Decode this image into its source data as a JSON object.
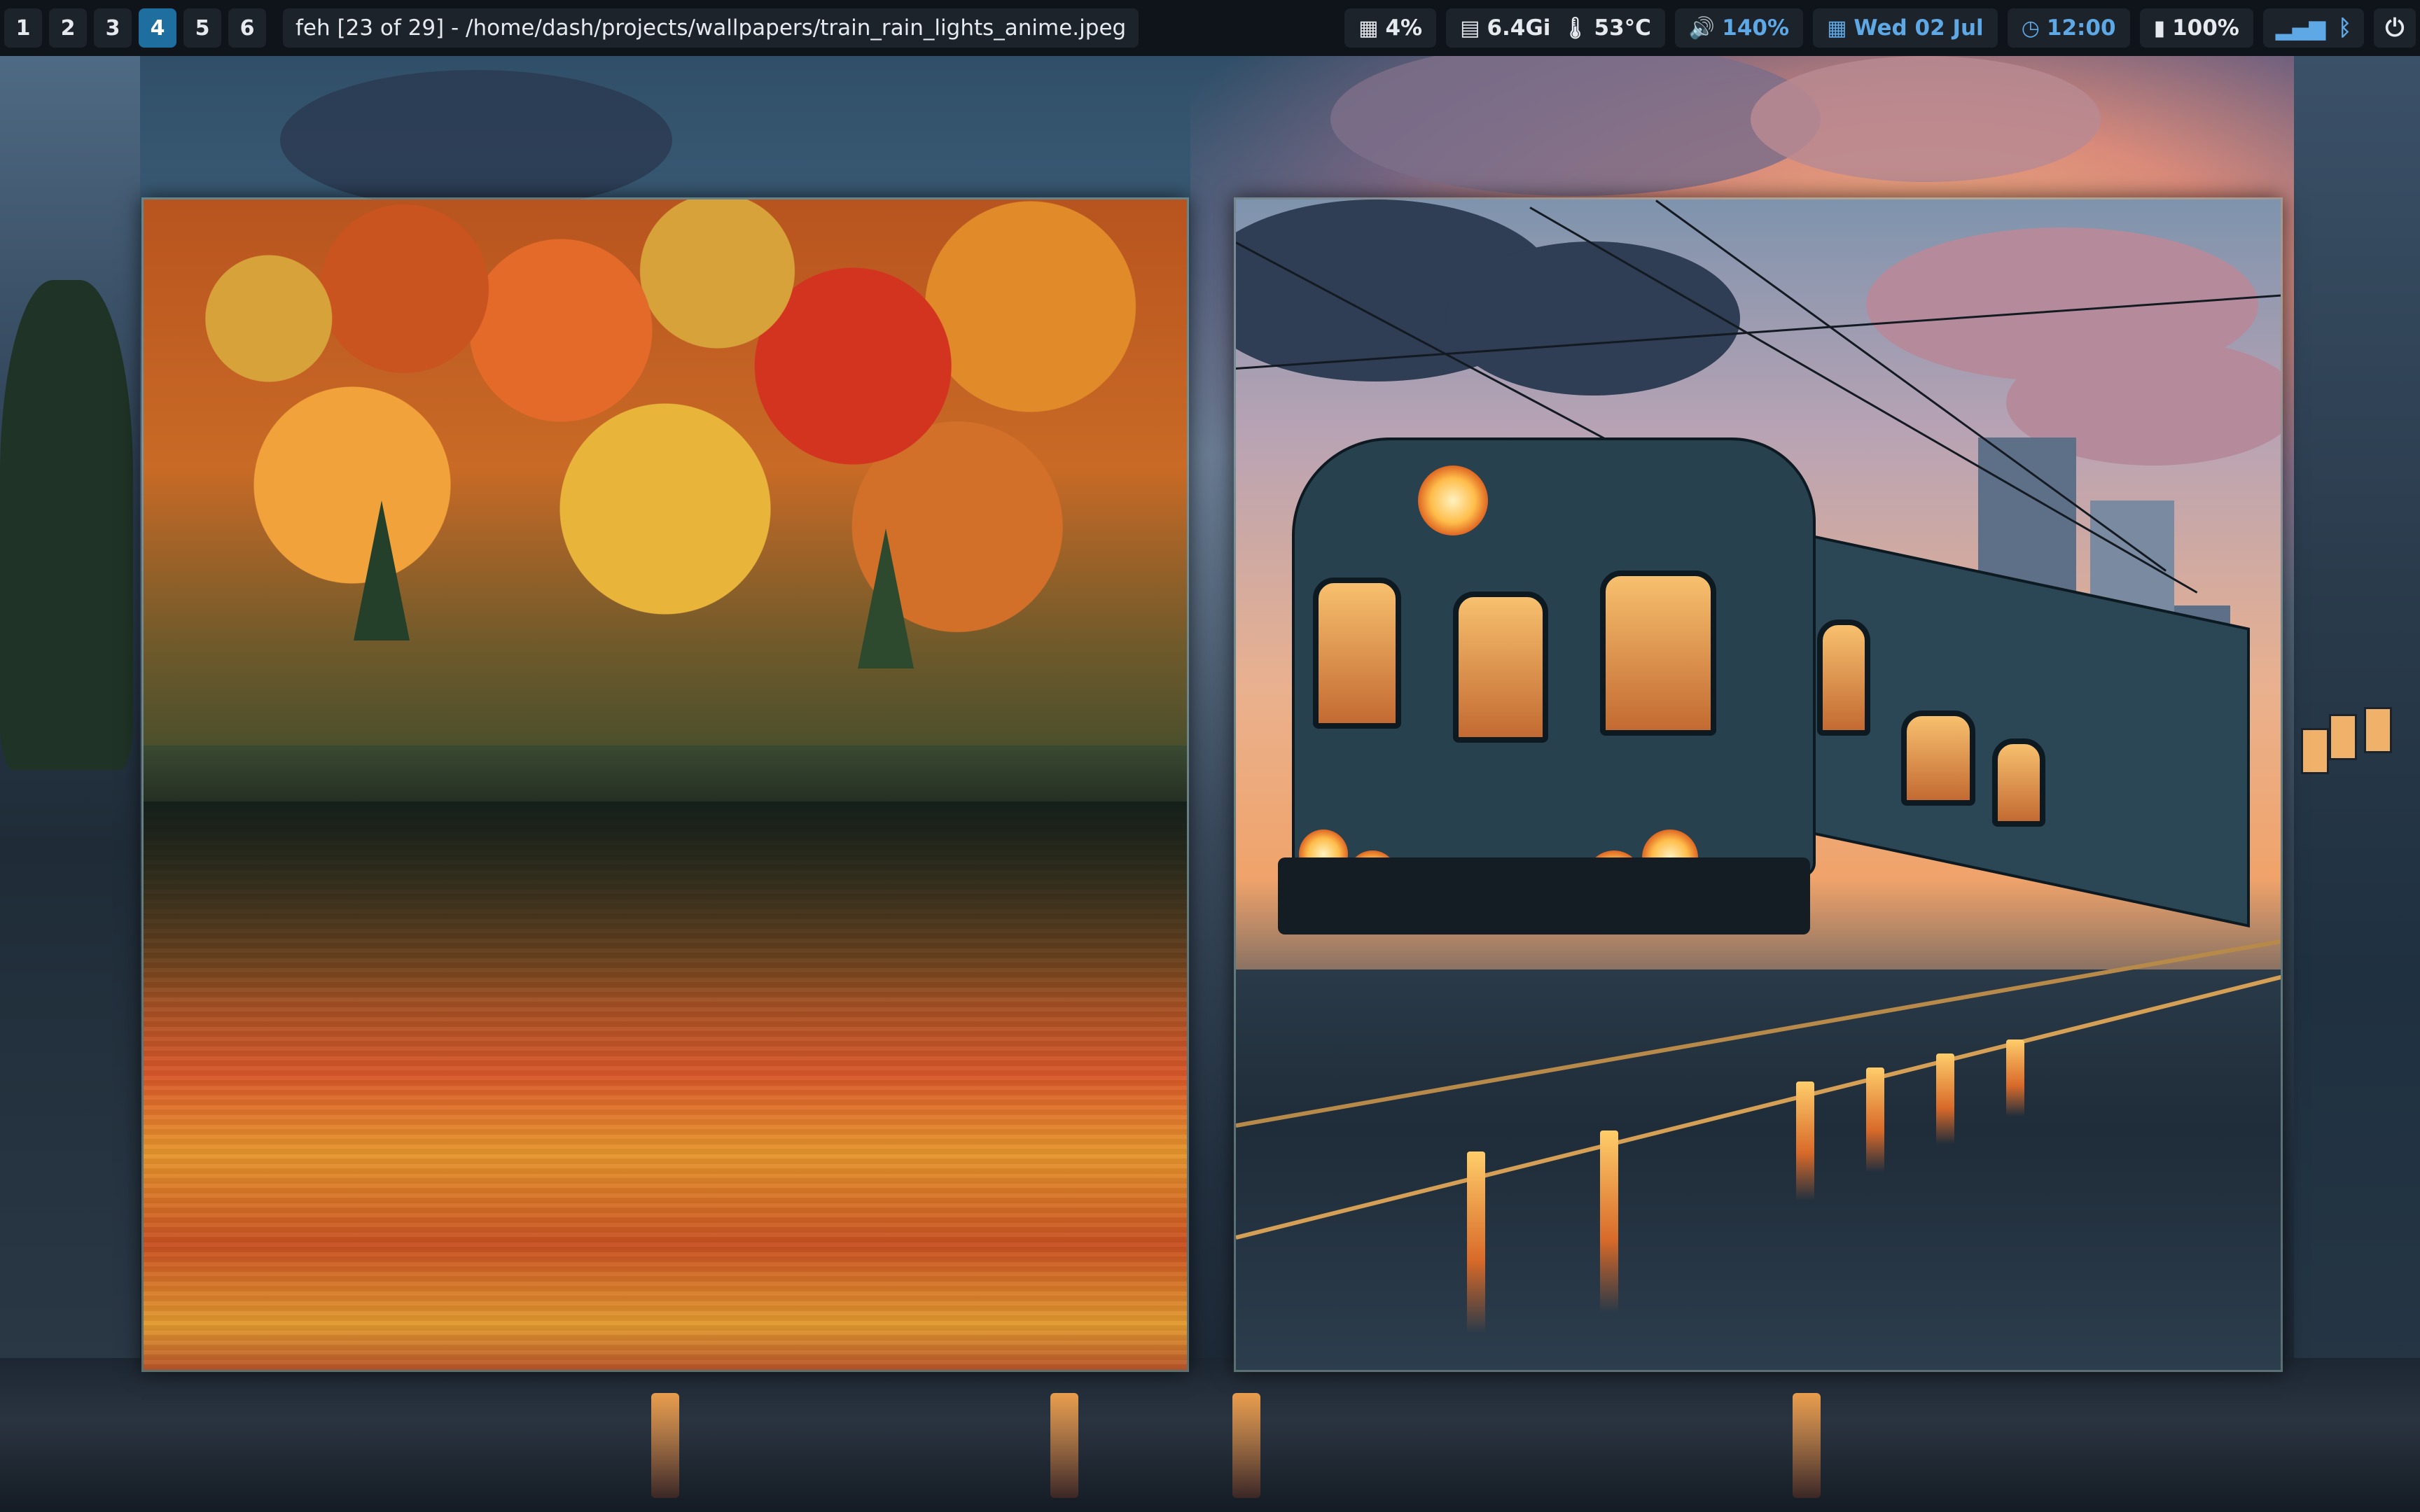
{
  "topbar": {
    "workspaces": [
      {
        "label": "1",
        "active": false
      },
      {
        "label": "2",
        "active": false
      },
      {
        "label": "3",
        "active": false
      },
      {
        "label": "4",
        "active": true
      },
      {
        "label": "5",
        "active": false
      },
      {
        "label": "6",
        "active": false
      }
    ],
    "window_title": "feh [23 of 29] - /home/dash/projects/wallpapers/train_rain_lights_anime.jpeg",
    "status": {
      "cpu": "4%",
      "memory": "6.4Gi",
      "temperature": "53°C",
      "volume": "140%",
      "date": "Wed 02 Jul",
      "time": "12:00",
      "battery": "100%"
    },
    "icons": {
      "cpu": "cpu-icon",
      "memory": "memory-icon",
      "temperature": "thermometer-icon",
      "volume": "speaker-icon",
      "date": "calendar-icon",
      "time": "clock-icon",
      "battery": "battery-icon",
      "network": "signal-icon",
      "bluetooth": "bluetooth-icon",
      "power": "power-icon"
    },
    "colors": {
      "bar_bg": "#0f141a",
      "pill_bg": "#1d232b",
      "active_workspace": "#1e6fa0",
      "accent": "#5fa8e6",
      "text": "#e6e9ee"
    }
  },
  "windows": [
    {
      "content": "autumn lake wallpaper image"
    },
    {
      "content": "anime train in rain wallpaper image"
    }
  ]
}
